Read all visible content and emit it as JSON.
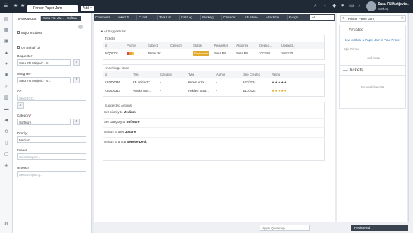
{
  "topbar": {
    "tab_title": "Printer Paper Jam",
    "add_label": "Add ▾",
    "user_name": "Sasa FN Matjevic...",
    "user_status": "Working"
  },
  "form": {
    "tabs": [
      "INQ0010302",
      "Sasa FN Ma...",
      "Softwa"
    ],
    "major_incident": "Major Incident",
    "on_behalf_of": "On Behalf Of",
    "requester_label": "Requester",
    "requester_value": "Sasa FN Matjevic - U...",
    "assignee_label": "Assignee",
    "assignee_value": "Sasa FN Matjevic - U...",
    "cc_label": "CC",
    "cc_placeholder": "Select CC...",
    "category_label": "Category",
    "category_value": "Software",
    "priority_label": "Priority",
    "priority_value": "Medium",
    "impact_label": "Impact",
    "impact_placeholder": "Select impact...",
    "urgency_label": "Urgency",
    "urgency_placeholder": "Select Urgency..."
  },
  "main": {
    "tabs": [
      "Comments",
      "Linked Ti...",
      "CI List",
      "Task List",
      "Call Log",
      "Working ...",
      "Calendar",
      "KB Article...",
      "Attachme...",
      "E-sign",
      "AI"
    ],
    "ai_suggestions": "AI Suggestions",
    "tickets_title": "Tickets",
    "tickets_headers": [
      "Id",
      "Priority",
      "Subject",
      "Category",
      "Status",
      "Requester",
      "Assignee",
      "Created...",
      "Updated..."
    ],
    "tickets_rows": [
      {
        "id": "INQ00101...",
        "subject": "Printer Pr...",
        "category": "",
        "status": "Registered",
        "requester": "Sasa FN...",
        "assignee": "Sasa FN...",
        "created": "10/11/20...",
        "updated": "10/11/20..."
      }
    ],
    "kb_title": "Knowledge Base",
    "kb_headers": [
      "Id",
      "Title",
      "Category",
      "Type",
      "Author",
      "Date Created",
      "Rating"
    ],
    "kb_rows": [
      {
        "id": "KB0000346",
        "title": "KB article 27 ...",
        "category": "-",
        "type": "Known error",
        "author": "-",
        "date": "2/27/2024",
        "rating": "★★★★★"
      },
      {
        "id": "KB0000313",
        "title": "Vendor num...",
        "category": "-",
        "type": "Problem Solu...",
        "author": "-",
        "date": "1/17/2024",
        "rating": "★★★★★"
      }
    ],
    "actions_title": "Suggested Actions",
    "actions": [
      {
        "text": "Set priority to",
        "value": "Medium"
      },
      {
        "text": "Set category to",
        "value": "Software"
      },
      {
        "text": "Assign to user",
        "value": "Josarie"
      },
      {
        "text": "Assign to group",
        "value": "Service Desk"
      }
    ]
  },
  "right": {
    "search_value": "Printer Paper Jam",
    "articles_title": "Articles",
    "article_link": "How to Clear a Paper Jam in Your Printer",
    "article_sub": "Epic Printer",
    "load_more": "Load more...",
    "tickets_title": "Tickets",
    "no_data": "No available data."
  },
  "bottom": {
    "quickstep_placeholder": "Apply Quickstep...",
    "status_value": "Registered"
  },
  "colors": {
    "topbar": "#1f2a36",
    "tab_dark": "#3a4450",
    "status_badge": "#e2a928",
    "link": "#2b6cb0"
  }
}
